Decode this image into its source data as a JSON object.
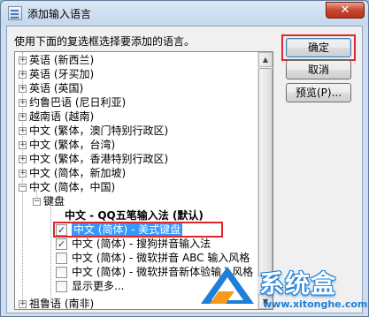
{
  "window": {
    "title": "添加输入语言",
    "close_label": "✕"
  },
  "dialog": {
    "instruction": "使用下面的复选框选择要添加的语言。"
  },
  "tree": {
    "languages": [
      "英语 (新西兰)",
      "英语 (牙买加)",
      "英语 (英国)",
      "约鲁巴语 (尼日利亚)",
      "越南语 (越南)",
      "中文 (繁体，澳门特别行政区)",
      "中文 (繁体，台湾)",
      "中文 (繁体，香港特别行政区)",
      "中文 (简体，新加坡)",
      "中文 (简体，中国)"
    ],
    "keyboard_label": "键盘",
    "default_ime": "中文 - QQ五笔输入法 (默认)",
    "ime_items": [
      {
        "label": "中文 (简体) - 美式键盘",
        "checked": true,
        "selected": true
      },
      {
        "label": "中文 (简体) - 搜狗拼音输入法",
        "checked": true,
        "selected": false
      },
      {
        "label": "中文 (简体) - 微软拼音 ABC 输入风格",
        "checked": false,
        "selected": false
      },
      {
        "label": "中文 (简体) - 微软拼音新体验输入风格",
        "checked": false,
        "selected": false
      },
      {
        "label": "显示更多...",
        "checked": false,
        "selected": false
      }
    ],
    "last_language": "祖鲁语 (南非)"
  },
  "buttons": {
    "ok": "确定",
    "cancel": "取消",
    "preview": "预览(P)..."
  },
  "watermark": {
    "text": "系统盒",
    "url": "www.xitonghe.com"
  },
  "colors": {
    "highlight_box": "#e0262a",
    "selection": "#3399ff",
    "watermark_blue": "#1d7fd6"
  }
}
